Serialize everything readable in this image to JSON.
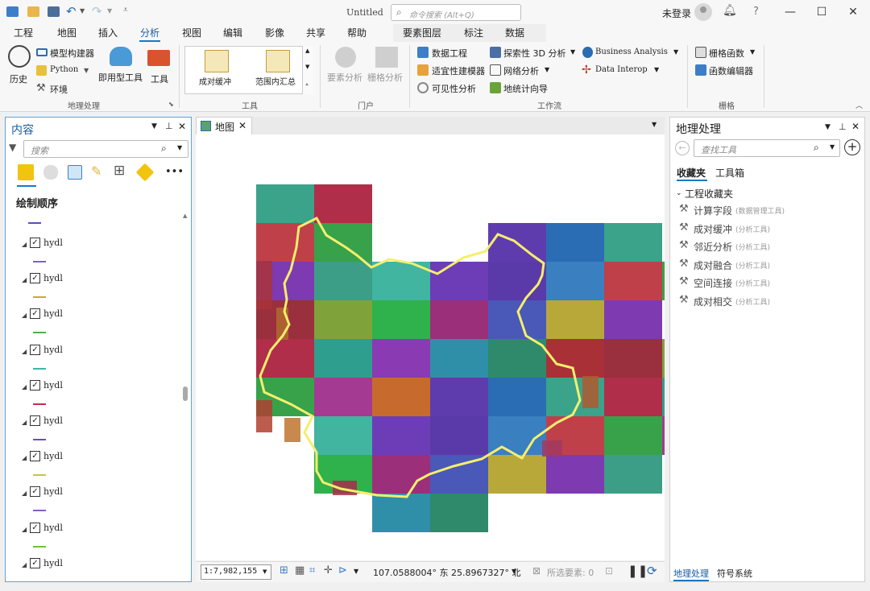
{
  "title_bar": {
    "app_title": "Untitled",
    "search_placeholder": "命令搜索 (Alt+Q)",
    "user": "未登录"
  },
  "tabs": [
    {
      "label": "工程"
    },
    {
      "label": "地图"
    },
    {
      "label": "插入"
    },
    {
      "label": "分析",
      "active": true
    },
    {
      "label": "视图"
    },
    {
      "label": "编辑"
    },
    {
      "label": "影像"
    },
    {
      "label": "共享"
    },
    {
      "label": "帮助"
    }
  ],
  "context_tabs": [
    {
      "label": "要素图层"
    },
    {
      "label": "标注"
    },
    {
      "label": "数据"
    }
  ],
  "ribbon": {
    "geoprocessing": {
      "group_label": "地理处理",
      "history": "历史",
      "model_builder": "模型构建器",
      "python": "Python",
      "environments": "环境",
      "ready_tools": "即用型工具",
      "tools": "工具"
    },
    "tools_gallery": {
      "group_label": "工具",
      "items": [
        "成对缓冲",
        "范围内汇总"
      ]
    },
    "portal": {
      "group_label": "门户",
      "feature_analysis": "要素分析",
      "raster_analysis": "栅格分析"
    },
    "workflows": {
      "group_label": "工作流",
      "data_engineering": "数据工程",
      "exploratory_3d": "探索性 3D 分析",
      "business_analysis": "Business Analysis",
      "suitability_modeler": "适宜性建模器",
      "network_analysis": "网络分析",
      "data_interop": "Data Interop",
      "visibility": "可见性分析",
      "geostat_wizard": "地统计向导"
    },
    "raster": {
      "group_label": "栅格",
      "raster_functions": "栅格函数",
      "function_editor": "函数编辑器"
    }
  },
  "contents_pane": {
    "title": "内容",
    "search_placeholder": "搜索",
    "drawing_order": "绘制顺序",
    "layers": [
      {
        "name": "hydl",
        "color": "#7a63c9"
      },
      {
        "name": "hydl",
        "color": "#c9a83a"
      },
      {
        "name": "hydl",
        "color": "#4caf50"
      },
      {
        "name": "hydl",
        "color": "#3fb6a6"
      },
      {
        "name": "hydl",
        "color": "#c0304a"
      },
      {
        "name": "hydl",
        "color": "#6a4fc4"
      },
      {
        "name": "hydl",
        "color": "#c7c25a"
      },
      {
        "name": "hydl",
        "color": "#8b5ac7"
      },
      {
        "name": "hydl",
        "color": "#6fc23a"
      },
      {
        "name": "hydl",
        "color": "#888888"
      }
    ],
    "top_swatch": "#5a4fc4"
  },
  "map_view": {
    "tab_label": "地图"
  },
  "status_bar": {
    "scale": "1:7,982,155",
    "coordinates": "107.0588004° 东 25.8967327° 北",
    "selected_features": "所选要素: 0"
  },
  "geoprocessing_pane": {
    "title": "地理处理",
    "search_placeholder": "查找工具",
    "tabs": [
      "收藏夹",
      "工具箱"
    ],
    "section": "工程收藏夹",
    "favorites": [
      {
        "name": "计算字段",
        "toolbox": "(数据管理工具)"
      },
      {
        "name": "成对缓冲",
        "toolbox": "(分析工具)"
      },
      {
        "name": "邻近分析",
        "toolbox": "(分析工具)"
      },
      {
        "name": "成对融合",
        "toolbox": "(分析工具)"
      },
      {
        "name": "空间连接",
        "toolbox": "(分析工具)"
      },
      {
        "name": "成对相交",
        "toolbox": "(分析工具)"
      }
    ],
    "bottom_tabs": [
      "地理处理",
      "符号系统"
    ]
  }
}
